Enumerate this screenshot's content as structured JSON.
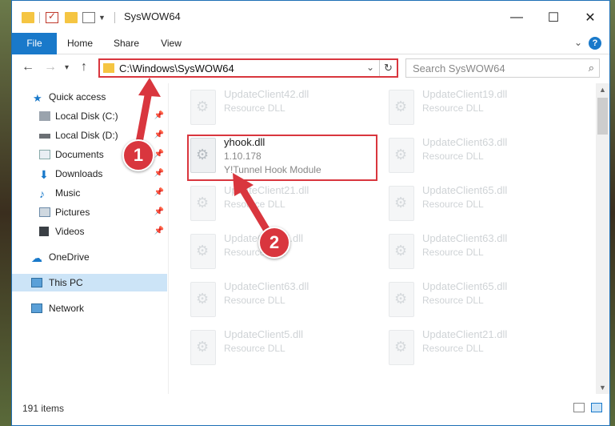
{
  "window": {
    "title": "SysWOW64",
    "controls": {
      "minimize": "—",
      "maximize": "☐",
      "close": "✕"
    }
  },
  "ribbon": {
    "tabs": [
      "File",
      "Home",
      "Share",
      "View"
    ],
    "help": "?"
  },
  "address": {
    "path": "C:\\Windows\\SysWOW64",
    "search_placeholder": "Search SysWOW64"
  },
  "sidebar": {
    "items": [
      {
        "label": "Quick access",
        "icon": "star-icon",
        "pinned": false
      },
      {
        "label": "Local Disk (C:)",
        "icon": "drive-icon",
        "pinned": true
      },
      {
        "label": "Local Disk (D:)",
        "icon": "drive-icon",
        "pinned": true
      },
      {
        "label": "Documents",
        "icon": "documents-icon",
        "pinned": true
      },
      {
        "label": "Downloads",
        "icon": "download-icon",
        "pinned": true
      },
      {
        "label": "Music",
        "icon": "music-icon",
        "pinned": true
      },
      {
        "label": "Pictures",
        "icon": "pictures-icon",
        "pinned": true
      },
      {
        "label": "Videos",
        "icon": "videos-icon",
        "pinned": true
      },
      {
        "label": "OneDrive",
        "icon": "cloud-icon",
        "pinned": false
      },
      {
        "label": "This PC",
        "icon": "pc-icon",
        "pinned": false,
        "selected": true
      },
      {
        "label": "Network",
        "icon": "network-icon",
        "pinned": false
      }
    ]
  },
  "files": {
    "selected": {
      "name": "yhook.dll",
      "version": "1.10.178",
      "description": "Y!Tunnel Hook Module"
    },
    "left_column": [
      {
        "name": "UpdateClient42.dll",
        "type": "Resource DLL"
      },
      {
        "name": "UpdateClient21.dll",
        "type": "Resource DLL"
      },
      {
        "name": "UpdateClient5.dll",
        "type": "Resource DLL"
      },
      {
        "name": "UpdateClient63.dll",
        "type": "Resource DLL"
      },
      {
        "name": "UpdateClient5.dll",
        "type": "Resource DLL"
      }
    ],
    "right_column": [
      {
        "name": "UpdateClient19.dll",
        "type": "Resource DLL"
      },
      {
        "name": "UpdateClient63.dll",
        "type": "Resource DLL"
      },
      {
        "name": "UpdateClient65.dll",
        "type": "Resource DLL"
      },
      {
        "name": "UpdateClient63.dll",
        "type": "Resource DLL"
      },
      {
        "name": "UpdateClient65.dll",
        "type": "Resource DLL"
      },
      {
        "name": "UpdateClient21.dll",
        "type": "Resource DLL"
      }
    ]
  },
  "status": {
    "item_count": "191 items"
  },
  "callouts": [
    "1",
    "2"
  ],
  "colors": {
    "accent": "#1979ca",
    "highlight": "#d9363e",
    "selected_bg": "#cce4f7"
  }
}
